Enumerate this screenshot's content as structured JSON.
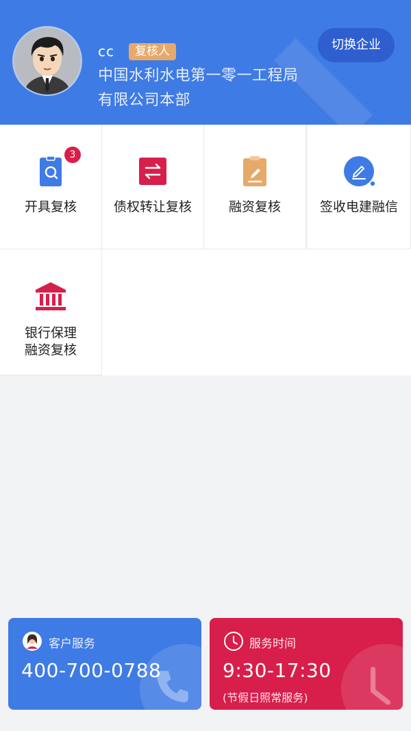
{
  "header": {
    "user_name": "cc",
    "role": "复核人",
    "company_line1": "中国水利水电第一零一工程局",
    "company_line2": "有限公司本部",
    "switch_label": "切换企业",
    "bg_color": "#3f7be4"
  },
  "menu": {
    "items": [
      {
        "label": "开具复核",
        "icon": "document-search-icon",
        "badge": "3",
        "color": "#3f7be4"
      },
      {
        "label": "债权转让复核",
        "icon": "transfer-icon",
        "color": "#d81e4a"
      },
      {
        "label": "融资复核",
        "icon": "clipboard-edit-icon",
        "color": "#e6a96a"
      },
      {
        "label": "签收电建融信",
        "icon": "sign-pen-icon",
        "color": "#3f7be4"
      },
      {
        "label_line1": "银行保理",
        "label_line2": "融资复核",
        "icon": "bank-icon",
        "color": "#d81e4a"
      }
    ]
  },
  "service": {
    "title": "客户服务",
    "phone": "400-700-0788",
    "icon": "service-avatar-icon"
  },
  "hours": {
    "title": "服务时间",
    "time": "9:30-17:30",
    "note": "(节假日照常服务)",
    "icon": "clock-icon"
  }
}
